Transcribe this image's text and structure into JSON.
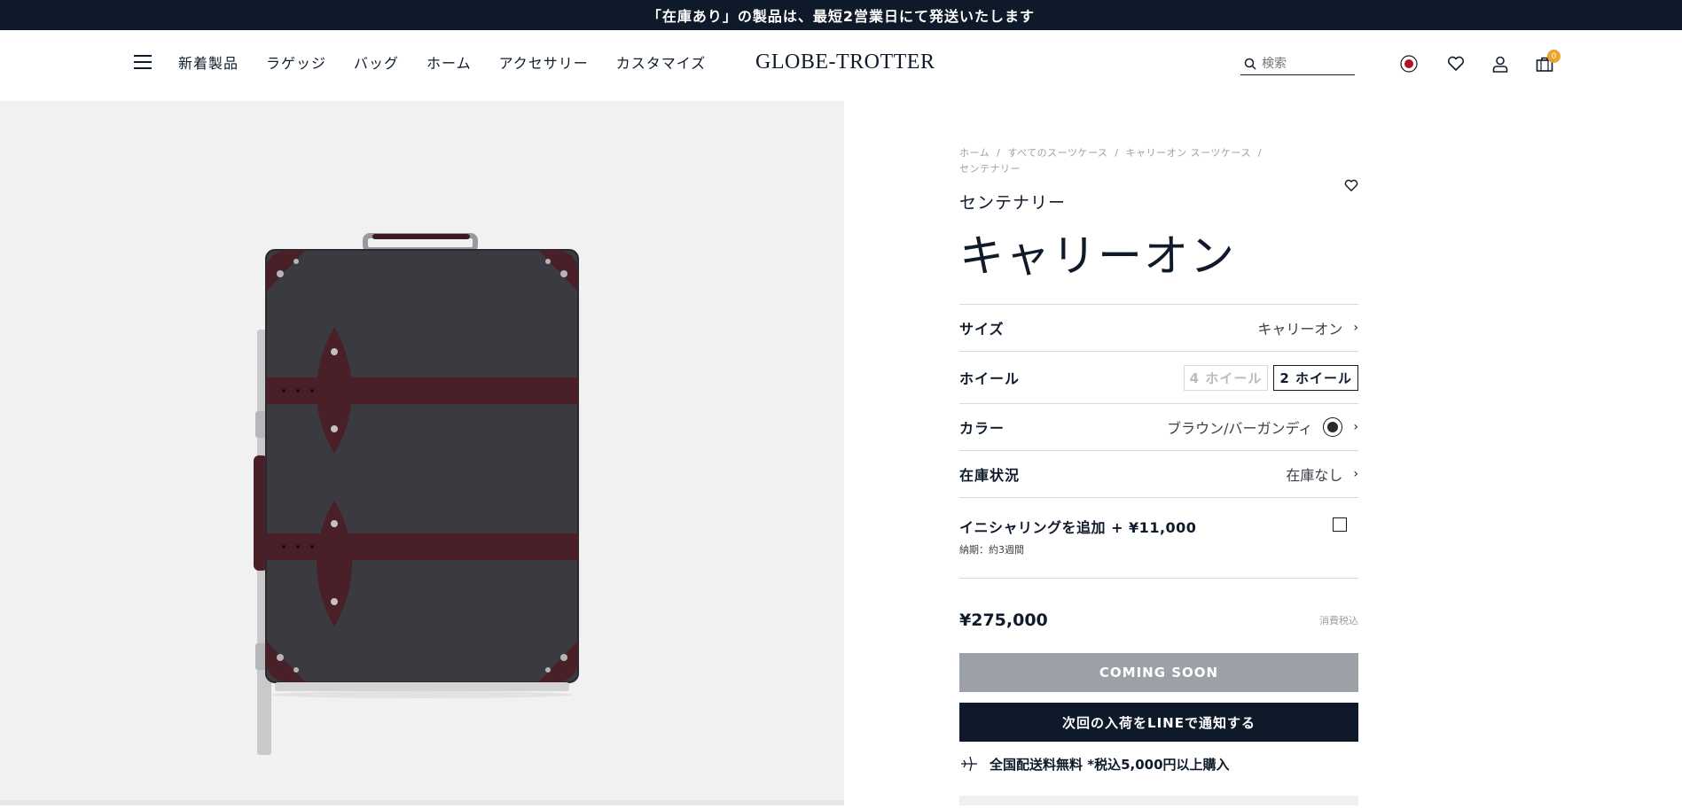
{
  "announcement": "「在庫あり」の製品は、最短2営業日にて発送いたします",
  "nav": {
    "items": [
      "新着製品",
      "ラゲッジ",
      "バッグ",
      "ホーム",
      "アクセサリー",
      "カスタマイズ"
    ]
  },
  "logo": "GLOBE-TROTTER",
  "search": {
    "placeholder": "検索"
  },
  "cart": {
    "count": "0"
  },
  "icons": [
    "menu-icon",
    "search-icon",
    "flag-japan-icon",
    "wishlist-heart-icon",
    "account-icon",
    "cart-bag-icon",
    "plane-icon",
    "chevron-right-icon"
  ],
  "breadcrumb": [
    "ホーム",
    "すべてのスーツケース",
    "キャリーオン スーツケース",
    "センテナリー"
  ],
  "product": {
    "collection": "センテナリー",
    "name": "キャリーオン",
    "options": {
      "size_label": "サイズ",
      "size_value": "キャリーオン",
      "wheel_label": "ホイール",
      "wheel_choices": [
        "4 ホイール",
        "2 ホイール"
      ],
      "wheel_selected": "2 ホイール",
      "color_label": "カラー",
      "color_value": "ブラウン/バーガンディ",
      "stock_label": "在庫状況",
      "stock_value": "在庫なし"
    },
    "initialing": {
      "title": "イニシャリングを追加 + ¥11,000",
      "note": "納期：約3週間"
    },
    "price": "¥275,000",
    "tax_note": "消費税込",
    "coming_soon": "COMING SOON",
    "line_notify": "次回の入荷をLINEで通知する",
    "shipping": "全国配送料無料 *税込5,000円以上購入"
  },
  "colors": {
    "navy": "#0e1a29",
    "badge": "#e9a52b",
    "disabled_button": "#9ca1a7",
    "case_body": "#3b3a40",
    "case_leather": "#4a2028"
  }
}
